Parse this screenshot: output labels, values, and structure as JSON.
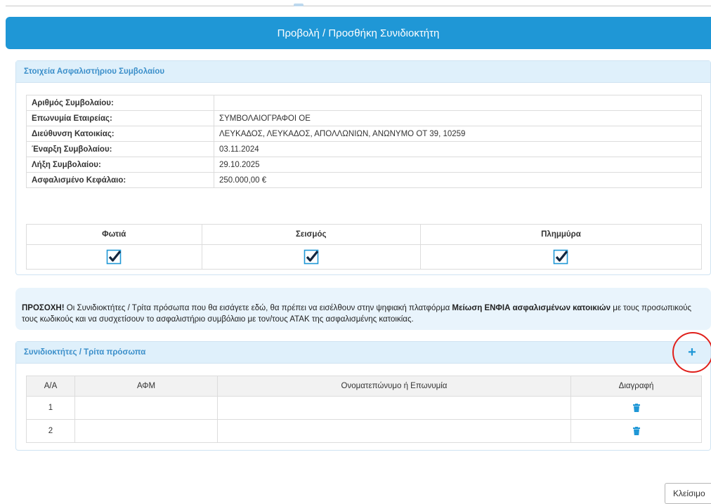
{
  "dialog": {
    "title": "Προβολή / Προσθήκη Συνιδιοκτήτη",
    "close_label": "Κλείσιμο"
  },
  "policy_panel": {
    "heading": "Στοιχεία Ασφαλιστήριου Συμβολαίου",
    "rows": [
      {
        "label": "Αριθμός Συμβολαίου:",
        "value": ""
      },
      {
        "label": "Επωνυμία Εταιρείας:",
        "value": "ΣΥΜΒΟΛΑΙΟΓΡΑΦΟΙ ΟΕ"
      },
      {
        "label": "Διεύθυνση Κατοικίας:",
        "value": "ΛΕΥΚΑΔΟΣ, ΛΕΥΚΑΔΟΣ, ΑΠΟΛΛΩΝΙΩΝ, ΑΝΩΝΥΜΟ ΟΤ 39, 10259"
      },
      {
        "label": "Έναρξη Συμβολαίου:",
        "value": "03.11.2024"
      },
      {
        "label": "Λήξη Συμβολαίου:",
        "value": "29.10.2025"
      },
      {
        "label": "Ασφαλισμένο Κεφάλαιο:",
        "value": "250.000,00 €"
      }
    ],
    "coverages": [
      {
        "label": "Φωτιά",
        "checked": true
      },
      {
        "label": "Σεισμός",
        "checked": true
      },
      {
        "label": "Πλημμύρα",
        "checked": true
      }
    ]
  },
  "notice": {
    "prefix": "ΠΡΟΣΟΧΗ!",
    "text1": " Οι Συνιδιοκτήτες / Τρίτα πρόσωπα που θα εισάγετε εδώ, θα πρέπει να εισέλθουν στην ψηφιακή πλατφόρμα ",
    "bold": "Μείωση ΕΝΦΙΑ ασφαλισμένων κατοικιών",
    "text2": " με τους προσωπικούς τους κωδικούς και να συσχετίσουν το ασφαλιστήριο συμβόλαιο με τον/τους ΑΤΑΚ της ασφαλισμένης κατοικίας."
  },
  "coowners_panel": {
    "heading": "Συνιδιοκτήτες / Τρίτα πρόσωπα",
    "add_label": "+",
    "columns": [
      "Α/Α",
      "ΑΦΜ",
      "Ονοματεπώνυμο ή Επωνυμία",
      "Διαγραφή"
    ],
    "rows": [
      {
        "aa": "1",
        "afm": "",
        "name": ""
      },
      {
        "aa": "2",
        "afm": "",
        "name": ""
      }
    ]
  },
  "colors": {
    "primary": "#1f97d6",
    "panel_heading_bg": "#dff0fb",
    "notice_bg": "#e9f4fc",
    "highlight": "#e0201b"
  }
}
